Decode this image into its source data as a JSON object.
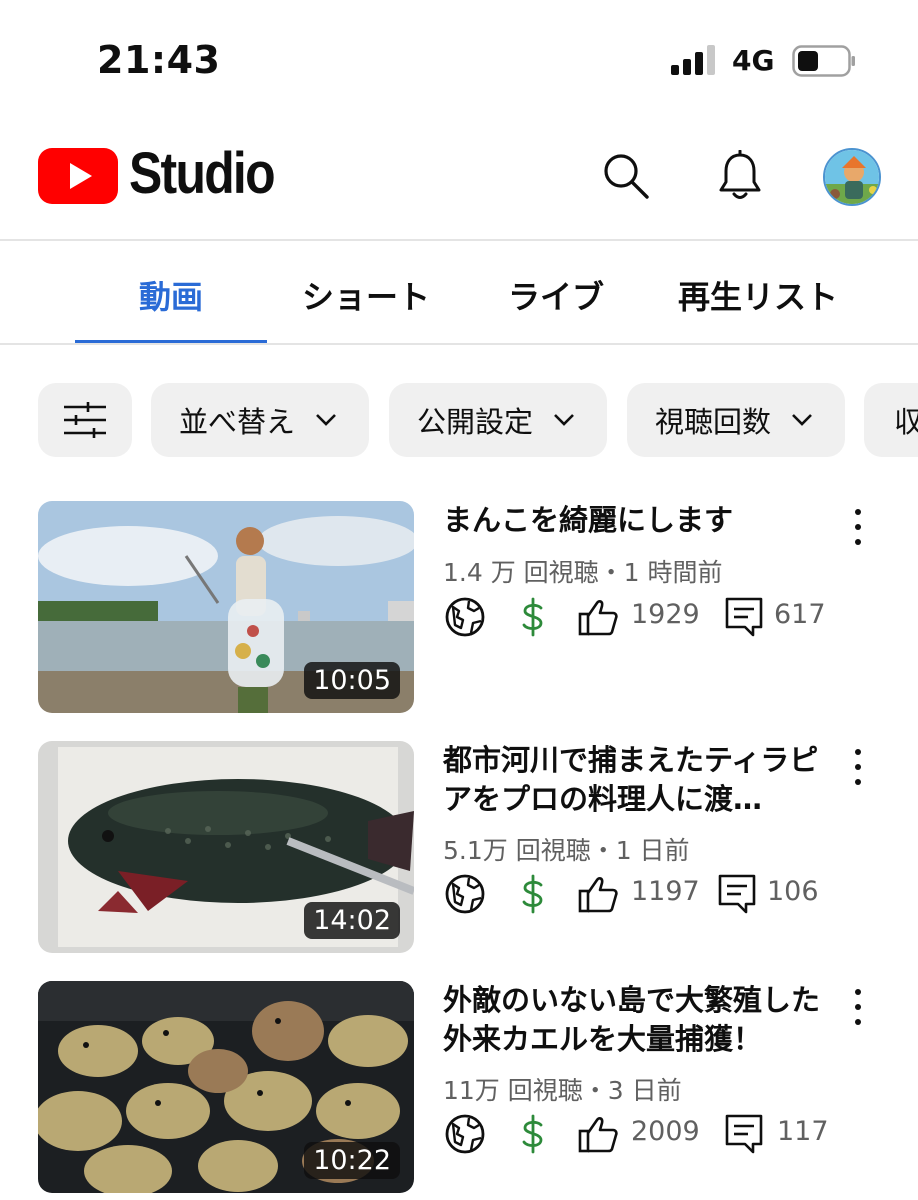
{
  "status_bar": {
    "time": "21:43",
    "network": "4G",
    "icons": [
      "signal-icon",
      "battery-icon"
    ]
  },
  "header": {
    "app_name": "Studio",
    "icons": [
      "youtube-logo-icon",
      "search-icon",
      "bell-icon",
      "avatar"
    ],
    "brand_color": "#ff0000"
  },
  "tabs": [
    {
      "label": "動画",
      "active": true
    },
    {
      "label": "ショート",
      "active": false
    },
    {
      "label": "ライブ",
      "active": false
    },
    {
      "label": "再生リスト",
      "active": false
    }
  ],
  "accent_color": "#2a6bd6",
  "filters": {
    "settings_icon": "sliders-icon",
    "chips": [
      "並べ替え",
      "公開設定",
      "視聴回数",
      "収"
    ]
  },
  "videos": [
    {
      "title": "まんこを綺麗にします",
      "meta": "1.4 万 回視聴・1 時間前",
      "duration": "10:05",
      "likes": "1929",
      "comments": "617",
      "visibility_icon": "globe-icon",
      "monetization_icon": "dollar-icon"
    },
    {
      "title": "都市河川で捕まえたティラピアをプロの料理人に渡…",
      "meta": "5.1万 回視聴・1 日前",
      "duration": "14:02",
      "likes": "1197",
      "comments": "106",
      "visibility_icon": "globe-icon",
      "monetization_icon": "dollar-icon"
    },
    {
      "title": "外敵のいない島で大繁殖した外来カエルを大量捕獲！",
      "meta": "11万 回視聴・3 日前",
      "duration": "10:22",
      "likes": "2009",
      "comments": "117",
      "visibility_icon": "globe-icon",
      "monetization_icon": "dollar-icon"
    }
  ]
}
